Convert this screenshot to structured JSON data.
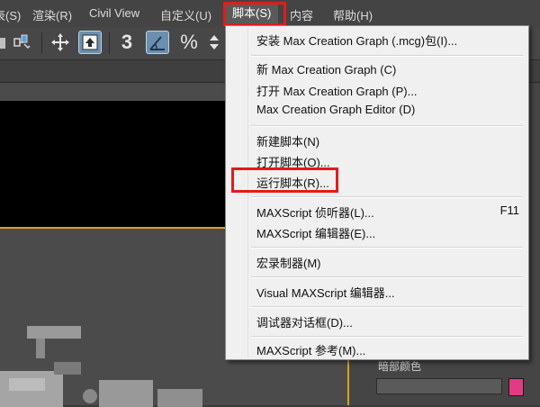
{
  "menubar": {
    "items": [
      {
        "label": "图表(S)"
      },
      {
        "label": "渲染(R)"
      },
      {
        "label": "Civil View"
      },
      {
        "label": "自定义(U)"
      },
      {
        "label": "脚本(S)",
        "active": true
      },
      {
        "label": "内容"
      },
      {
        "label": "帮助(H)"
      }
    ]
  },
  "toolbar": {
    "icons": [
      "link-icon",
      "move-icon",
      "select-region-icon",
      "snap-3-icon",
      "angle-snap-icon",
      "percent-snap-icon",
      "spinner-snap-icon"
    ],
    "snap_label": "3"
  },
  "script_menu": {
    "items": [
      {
        "label": "安装 Max Creation Graph (.mcg)包(I)..."
      },
      {
        "label": "新 Max Creation Graph (C)"
      },
      {
        "label": "打开 Max Creation Graph (P)..."
      },
      {
        "label": "Max Creation Graph Editor (D)"
      },
      {
        "label": "新建脚本(N)"
      },
      {
        "label": "打开脚本(O)..."
      },
      {
        "label": "运行脚本(R)...",
        "highlighted": true
      },
      {
        "label": "MAXScript 侦听器(L)...",
        "shortcut": "F11"
      },
      {
        "label": "MAXScript 编辑器(E)..."
      },
      {
        "label": "宏录制器(M)"
      },
      {
        "label": "Visual MAXScript 编辑器..."
      },
      {
        "label": "调试器对话框(D)..."
      },
      {
        "label": "MAXScript 参考(M)..."
      }
    ]
  },
  "right_panel": {
    "label": "暗部颜色",
    "swatch_color": "#e23b83"
  },
  "colors": {
    "highlight_border": "#e11c1c",
    "viewport_border": "#d7a21d"
  }
}
